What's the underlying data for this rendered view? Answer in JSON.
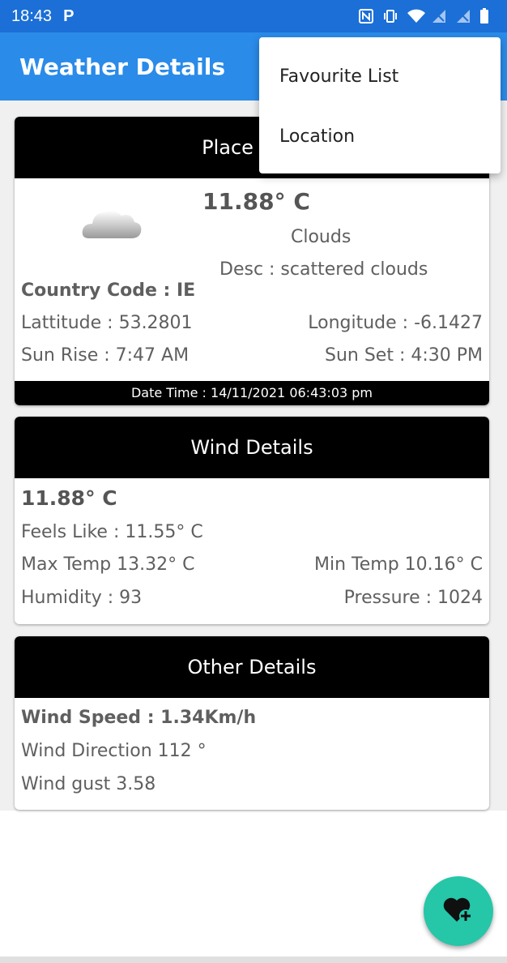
{
  "status_bar": {
    "time": "18:43",
    "p_badge": "P",
    "icons": [
      "nfc-icon",
      "vibrate-icon",
      "wifi-icon",
      "signal-icon",
      "signal-icon",
      "battery-icon"
    ]
  },
  "app_bar": {
    "title": "Weather Details",
    "color": "#2a8be9"
  },
  "menu": {
    "items": [
      {
        "label": "Favourite List"
      },
      {
        "label": "Location"
      }
    ]
  },
  "weather_card": {
    "header": "Place : Sal",
    "temperature": "11.88° C",
    "condition": "Clouds",
    "description": "Desc : scattered clouds",
    "country_code": "Country Code : IE",
    "latitude": "Lattitude : 53.2801",
    "longitude": "Longitude : -6.1427",
    "sunrise": "Sun Rise : 7:47 AM",
    "sunset": "Sun Set : 4:30 PM",
    "footer": "Date Time : 14/11/2021 06:43:03 pm"
  },
  "wind_card": {
    "header": "Wind Details",
    "temperature": "11.88° C",
    "feels_like": "Feels Like : 11.55° C",
    "max_temp": "Max Temp 13.32° C",
    "min_temp": "Min Temp 10.16° C",
    "humidity": "Humidity : 93",
    "pressure": "Pressure : 1024"
  },
  "other_card": {
    "header": "Other Details",
    "wind_speed": "Wind Speed : 1.34Km/h",
    "wind_direction": "Wind Direction 112 °",
    "wind_gust": "Wind gust 3.58"
  },
  "fab": {
    "icon": "heart-plus-icon",
    "color": "#26c6a8"
  }
}
